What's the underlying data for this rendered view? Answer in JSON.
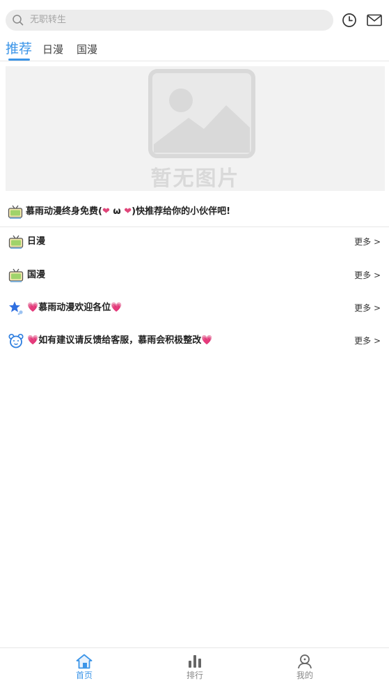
{
  "search": {
    "placeholder": "无职转生"
  },
  "header_icons": [
    "history-icon",
    "mail-icon"
  ],
  "tabs": [
    {
      "label": "推荐",
      "active": true
    },
    {
      "label": "日漫",
      "active": false
    },
    {
      "label": "国漫",
      "active": false
    }
  ],
  "banner": {
    "placeholder_text": "暂无图片"
  },
  "notice": {
    "pre": "慕雨动漫终身免费(",
    "heart": "❤",
    "omega": " ω ",
    "post": ")快推荐给你的小伙伴吧!"
  },
  "sections": [
    {
      "title": "日漫",
      "more": "更多 >",
      "icon": "tv-icon"
    },
    {
      "title": "国漫",
      "more": "更多 >",
      "icon": "tv-icon"
    },
    {
      "title": "慕雨动漫欢迎各位",
      "more": "更多 >",
      "icon": "star-icon"
    },
    {
      "title": "如有建议请反馈给客服，慕雨会积极整改",
      "more": "更多 >",
      "icon": "bear-icon"
    }
  ],
  "nav": [
    {
      "label": "首页",
      "icon": "home-icon",
      "active": true
    },
    {
      "label": "排行",
      "icon": "ranking-icon",
      "active": false
    },
    {
      "label": "我的",
      "icon": "profile-icon",
      "active": false
    }
  ],
  "colors": {
    "accent": "#3b95e8",
    "heart": "#e0467a",
    "placeholder_gray": "#d9d9d9"
  }
}
